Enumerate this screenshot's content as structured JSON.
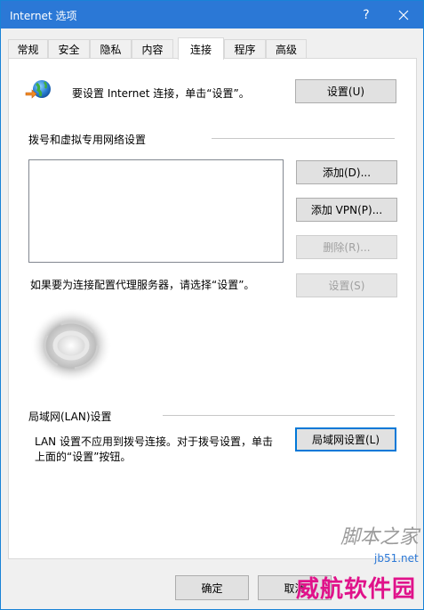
{
  "window": {
    "title": "Internet 选项",
    "help_glyph": "?",
    "close_glyph": "✕"
  },
  "tabs": [
    {
      "label": "常规",
      "active": false
    },
    {
      "label": "安全",
      "active": false
    },
    {
      "label": "隐私",
      "active": false
    },
    {
      "label": "内容",
      "active": false
    },
    {
      "label": "连接",
      "active": true
    },
    {
      "label": "程序",
      "active": false
    },
    {
      "label": "高级",
      "active": false
    }
  ],
  "setup": {
    "icon": "globe-network-icon",
    "text": "要设置 Internet 连接，单击“设置”。",
    "button": "设置(U)"
  },
  "dialup": {
    "heading": "拨号和虚拟专用网络设置",
    "add_button": "添加(D)...",
    "add_vpn_button": "添加 VPN(P)...",
    "remove_button": "删除(R)...",
    "proxy_text": "如果要为连接配置代理服务器，请选择“设置”。",
    "settings_button": "设置(S)"
  },
  "lan": {
    "heading": "局域网(LAN)设置",
    "text_line1": "LAN 设置不应用到拨号连接。对于拨号设置，单击",
    "text_line2": "上面的“设置”按钮。",
    "button": "局域网设置(L)"
  },
  "footer": {
    "ok_button": "确定",
    "cancel_button": "取消"
  },
  "watermark": {
    "site_name": "脚本之家",
    "brand": "威航软件园",
    "url": "jb51.net"
  },
  "colors": {
    "titlebar": "#2b78d6",
    "watermark": "#e0128a"
  }
}
